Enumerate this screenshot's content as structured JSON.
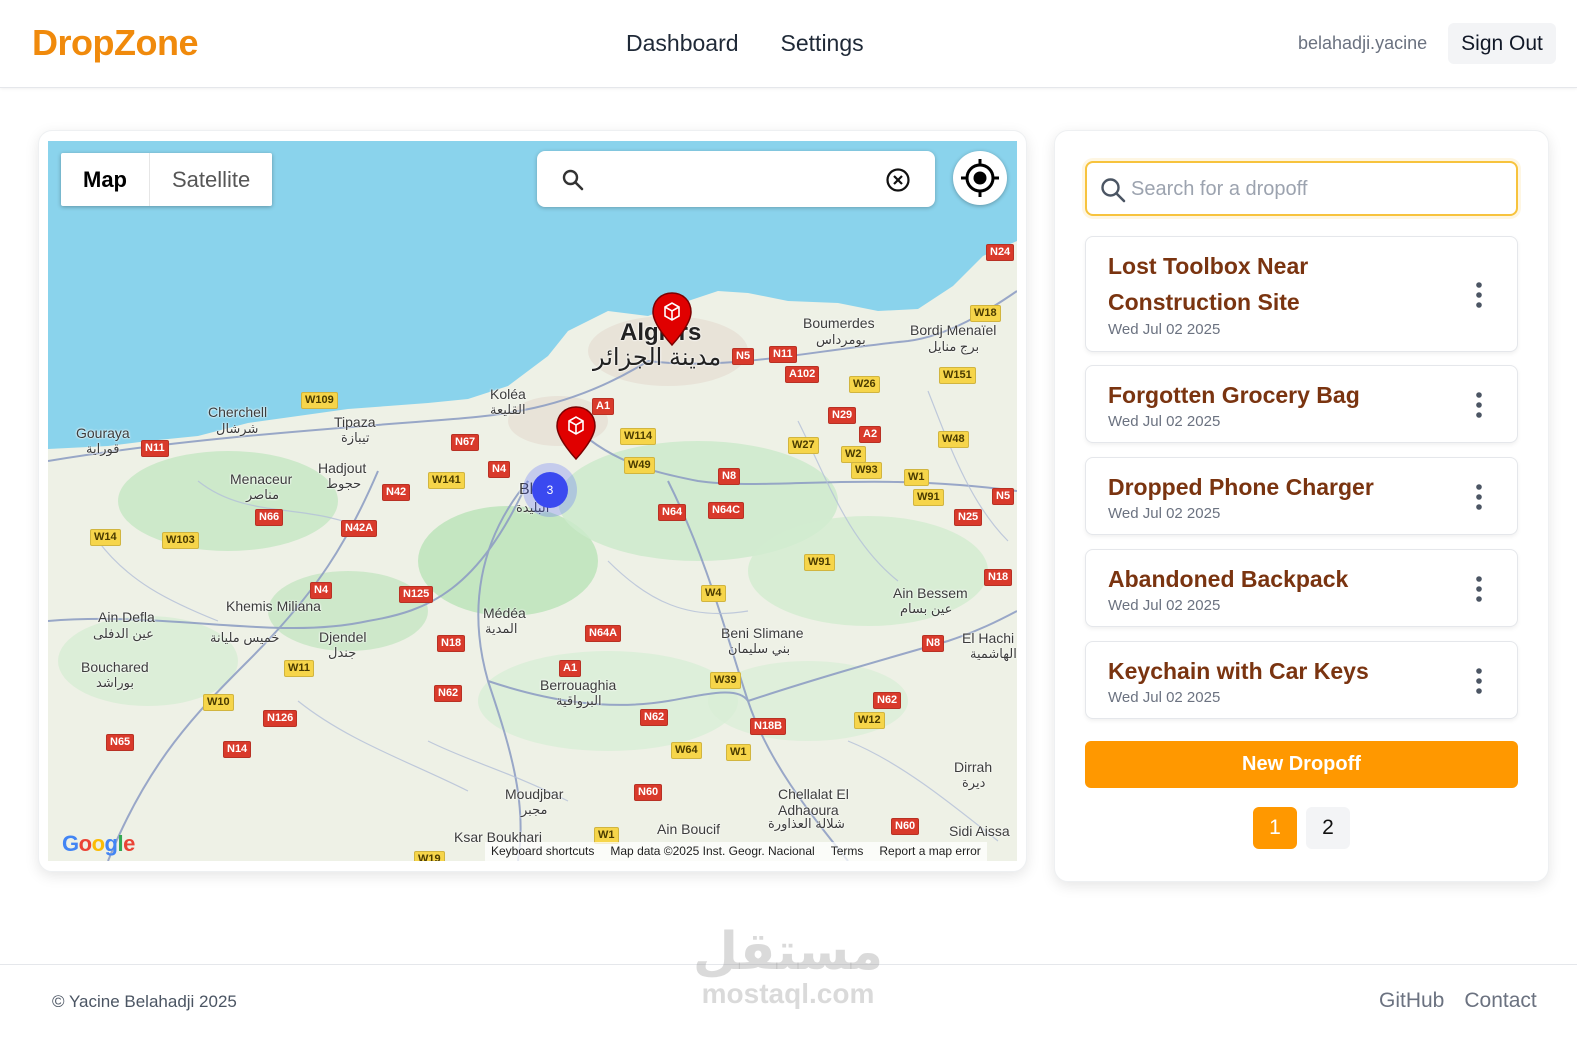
{
  "header": {
    "logo": "DropZone",
    "nav": [
      "Dashboard",
      "Settings"
    ],
    "username": "belahadji.yacine",
    "signout_label": "Sign Out"
  },
  "map": {
    "type_options": [
      "Map",
      "Satellite"
    ],
    "active_type": "Map",
    "cluster_count": "3",
    "google_logo": "Google",
    "attribution": [
      "Keyboard shortcuts",
      "Map data ©2025 Inst. Geogr. Nacional",
      "Terms",
      "Report a map error"
    ],
    "places": [
      {
        "name": "Algiers",
        "ar": "مدينة الجزائر"
      },
      {
        "name": "Boumerdes",
        "ar": "بومرداس"
      },
      {
        "name": "Bordj Menaïel",
        "ar": "برج منايل"
      },
      {
        "name": "Koléa",
        "ar": "القليعة"
      },
      {
        "name": "Cherchell",
        "ar": "شرشال"
      },
      {
        "name": "Tipaza",
        "ar": "تيبازة"
      },
      {
        "name": "Gouraya",
        "ar": "قوراية"
      },
      {
        "name": "Menaceur",
        "ar": "مناصر"
      },
      {
        "name": "Hadjout",
        "ar": "حجوط"
      },
      {
        "name": "Blida",
        "ar": "البليدة"
      },
      {
        "name": "Khemis Miliana",
        "ar": "خميس مليانة"
      },
      {
        "name": "Ain Defla",
        "ar": "عين الدفلى"
      },
      {
        "name": "Djendel",
        "ar": "جندل"
      },
      {
        "name": "Bouchared",
        "ar": "بوراشد"
      },
      {
        "name": "Médéa",
        "ar": "المدية"
      },
      {
        "name": "Beni Slimane",
        "ar": "بني سليمان"
      },
      {
        "name": "Berrouaghia",
        "ar": "البرواقية"
      },
      {
        "name": "Ain Bessem",
        "ar": "عين بسام"
      },
      {
        "name": "El Hachi",
        "ar": "الهاشمية"
      },
      {
        "name": "Dirrah",
        "ar": "ديرة"
      },
      {
        "name": "Moudjbar",
        "ar": "مجبر"
      },
      {
        "name": "Chellalat El Adhaoura",
        "ar": "شلالة العذاورة"
      },
      {
        "name": "Ksar Boukhari",
        "ar": "قصر البخاري"
      },
      {
        "name": "Ain Boucif",
        "ar": ""
      },
      {
        "name": "Sidi Aissa",
        "ar": ""
      }
    ],
    "shields": [
      "N24",
      "W18",
      "N5",
      "N11",
      "A102",
      "W26",
      "W151",
      "N29",
      "A2",
      "W48",
      "A1",
      "W114",
      "N67",
      "W109",
      "N11",
      "W27",
      "W2",
      "W93",
      "W1",
      "W91",
      "N5",
      "N4",
      "W141",
      "N42",
      "W49",
      "N8",
      "N64",
      "N64C",
      "N25",
      "N66",
      "N42A",
      "W14",
      "W103",
      "W91",
      "N18",
      "N4",
      "N125",
      "W4",
      "N64A",
      "N18",
      "N8",
      "W11",
      "A1",
      "W39",
      "N62",
      "N62",
      "W10",
      "N126",
      "N62",
      "N18B",
      "W12",
      "N65",
      "N14",
      "W64",
      "W1",
      "N60",
      "N60",
      "W1",
      "W19"
    ]
  },
  "dropoffs": {
    "search_placeholder": "Search for a dropoff",
    "items": [
      {
        "title": "Lost Toolbox Near Construction Site",
        "date": "Wed Jul 02 2025"
      },
      {
        "title": "Forgotten Grocery Bag",
        "date": "Wed Jul 02 2025"
      },
      {
        "title": "Dropped Phone Charger",
        "date": "Wed Jul 02 2025"
      },
      {
        "title": "Abandoned Backpack",
        "date": "Wed Jul 02 2025"
      },
      {
        "title": "Keychain with Car Keys",
        "date": "Wed Jul 02 2025"
      }
    ],
    "new_label": "New Dropoff",
    "pages": [
      "1",
      "2"
    ],
    "current_page": 1
  },
  "footer": {
    "copyright": "© Yacine Belahadji 2025",
    "links": [
      "GitHub",
      "Contact"
    ],
    "watermark_ar": "مستقل",
    "watermark_en": "mostaql.com"
  },
  "colors": {
    "brand": "#f08a0c",
    "accent": "#ff9800",
    "item_title": "#7a3410",
    "water": "#8ad3ec",
    "land": "#eef1e6"
  }
}
